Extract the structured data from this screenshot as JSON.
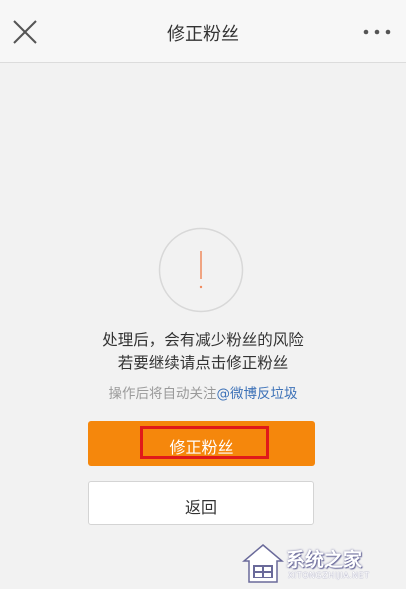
{
  "nav": {
    "title": "修正粉丝",
    "close_icon": "close-icon",
    "more_icon": "more-icon"
  },
  "dialog": {
    "icon": "exclamation-circle-icon",
    "message_line1": "处理后，会有减少粉丝的风险",
    "message_line2": "若要继续请点击修正粉丝",
    "note_prefix": "操作后将自动关注",
    "note_link": "@微博反垃圾"
  },
  "buttons": {
    "primary_label": "修正粉丝",
    "secondary_label": "返回"
  },
  "watermark": {
    "text": "系统之家",
    "sub": "XITONGZHIJIA.NET"
  },
  "colors": {
    "accent": "#f5870c",
    "highlight_border": "#e01a1a",
    "link": "#3d72b8",
    "alert_icon": "#f08a5d"
  }
}
